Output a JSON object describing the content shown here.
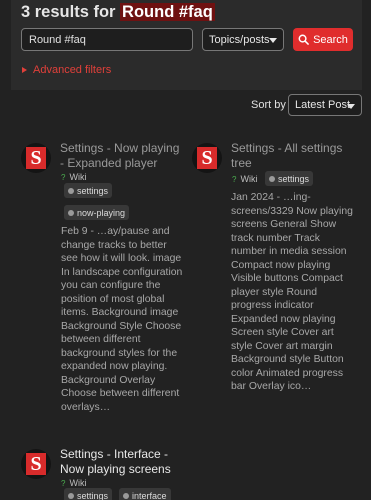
{
  "search": {
    "heading_prefix": "3 results for",
    "heading_term": "Round #faq",
    "query": "Round #faq",
    "type_value": "Topics/posts",
    "button_label": "Search",
    "advanced_filters_label": "Advanced filters"
  },
  "sort": {
    "label": "Sort by",
    "value": "Latest Post"
  },
  "results": [
    {
      "title": "Settings - Now playing - Expanded player",
      "category": "Wiki",
      "tags": [
        "settings",
        "now-playing"
      ],
      "blurb": "Feb 9 - …ay/pause and change tracks to better see how it will look. image In landscape configuration you can configure the position of most global items. Background image Background Style Choose between different background styles for the expanded now playing. Background Overlay Choose between different overlays…"
    },
    {
      "title": "Settings - All settings tree",
      "category": "Wiki",
      "tags": [
        "settings"
      ],
      "blurb": "Jan 2024 - …ing-screens/3329 Now playing screens General Show track number Track number in media session Compact now playing Visible buttons Compact player style Round progress indicator Expanded now playing Screen style Cover art style Cover art margin Background style Button color Animated progress bar Overlay ico…"
    },
    {
      "title": "Settings - Interface - Now playing screens",
      "category": "Wiki",
      "tags": [
        "settings",
        "interface"
      ],
      "blurb": ""
    }
  ],
  "colors": {
    "accent": "#e02d2d",
    "highlight_bg": "#6e1111",
    "wiki_icon": "#4caf50"
  },
  "icons": {
    "search": "search-icon",
    "avatar": "app-logo-s"
  }
}
